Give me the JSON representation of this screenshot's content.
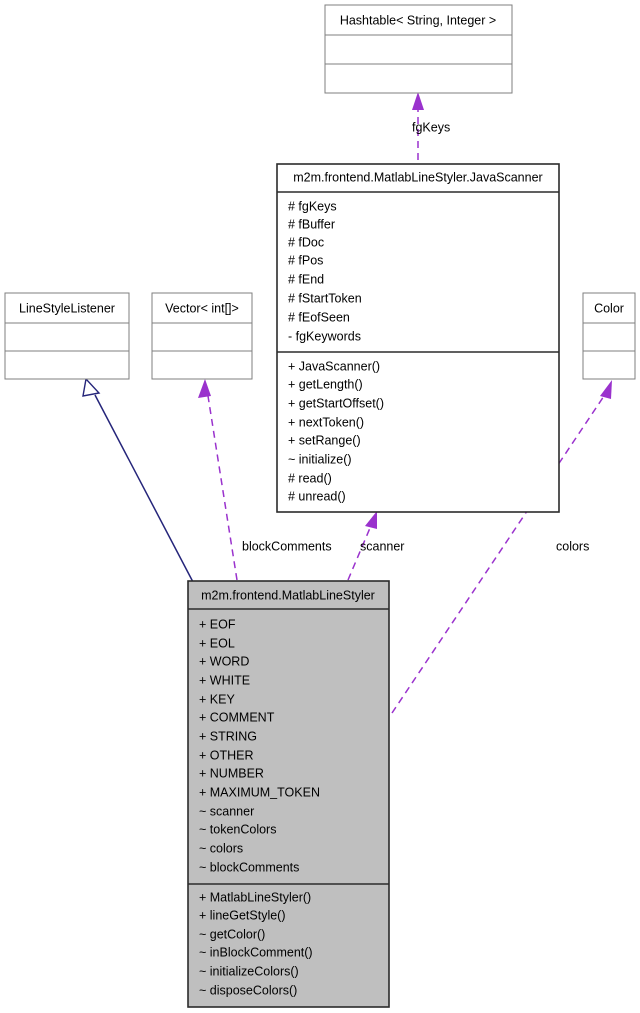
{
  "diagram": {
    "kind": "uml-class-diagram",
    "title_visible": false,
    "colors": {
      "usage_edge": "#9a32cd",
      "inheritance_edge": "#25257a",
      "highlight_box_fill": "#bfbfbf",
      "plain_box_fill": "#ffffff",
      "plain_box_border": "#7f7f7f",
      "strong_box_border": "#2b2b2b",
      "text": "#000000"
    },
    "classes": [
      {
        "id": "hashtable",
        "name": "Hashtable< String, Integer >",
        "style": "plain",
        "attributes": [],
        "operations": []
      },
      {
        "id": "javascanner",
        "name": "m2m.frontend.MatlabLineStyler.JavaScanner",
        "style": "strong",
        "attributes": [
          "# fgKeys",
          "# fBuffer",
          "# fDoc",
          "# fPos",
          "# fEnd",
          "# fStartToken",
          "# fEofSeen",
          "- fgKeywords"
        ],
        "operations": [
          "+ JavaScanner()",
          "+ getLength()",
          "+ getStartOffset()",
          "+ nextToken()",
          "+ setRange()",
          "~ initialize()",
          "# read()",
          "# unread()"
        ]
      },
      {
        "id": "linestylelistener",
        "name": "LineStyleListener",
        "style": "plain",
        "attributes": [],
        "operations": []
      },
      {
        "id": "vector",
        "name": "Vector< int[]>",
        "style": "plain",
        "attributes": [],
        "operations": []
      },
      {
        "id": "color",
        "name": "Color",
        "style": "plain",
        "attributes": [],
        "operations": []
      },
      {
        "id": "matlablinestyler",
        "name": "m2m.frontend.MatlabLineStyler",
        "style": "highlight",
        "attributes": [
          "+ EOF",
          "+ EOL",
          "+ WORD",
          "+ WHITE",
          "+ KEY",
          "+ COMMENT",
          "+ STRING",
          "+ OTHER",
          "+ NUMBER",
          "+ MAXIMUM_TOKEN",
          "~ scanner",
          "~ tokenColors",
          "~ colors",
          "~ blockComments"
        ],
        "operations": [
          "+ MatlabLineStyler()",
          "+ lineGetStyle()",
          "~ getColor()",
          "~ inBlockComment()",
          "~ initializeColors()",
          "~ disposeColors()"
        ]
      }
    ],
    "edges": [
      {
        "id": "edge-fgkeys",
        "label": "fgKeys",
        "type": "usage",
        "from": "javascanner",
        "to": "hashtable"
      },
      {
        "id": "edge-blockcomments",
        "label": "blockComments",
        "type": "usage",
        "from": "matlablinestyler",
        "to": "vector"
      },
      {
        "id": "edge-scanner",
        "label": "scanner",
        "type": "usage",
        "from": "matlablinestyler",
        "to": "javascanner"
      },
      {
        "id": "edge-colors",
        "label": "colors",
        "type": "usage",
        "from": "matlablinestyler",
        "to": "color"
      },
      {
        "id": "edge-inheritance",
        "label": "",
        "type": "inheritance",
        "from": "matlablinestyler",
        "to": "linestylelistener"
      }
    ]
  }
}
